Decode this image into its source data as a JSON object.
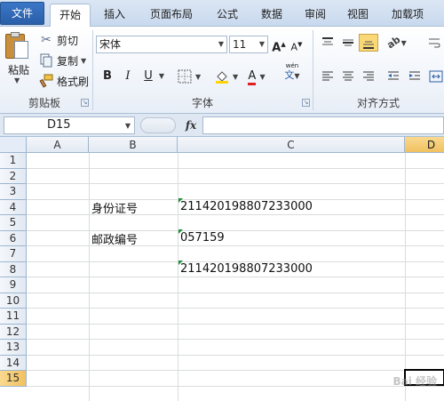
{
  "ribbon_tabs": [
    {
      "label": "文件"
    },
    {
      "label": "开始"
    },
    {
      "label": "插入"
    },
    {
      "label": "页面布局"
    },
    {
      "label": "公式"
    },
    {
      "label": "数据"
    },
    {
      "label": "审阅"
    },
    {
      "label": "视图"
    },
    {
      "label": "加载项"
    }
  ],
  "clipboard": {
    "paste": "粘贴",
    "cut": "剪切",
    "copy": "复制",
    "format_painter": "格式刷",
    "group": "剪贴板"
  },
  "font": {
    "name": "宋体",
    "size": "11",
    "bold": "B",
    "italic": "I",
    "underline": "U",
    "group": "字体",
    "font_color": "A",
    "phonetic": "wén"
  },
  "alignment": {
    "group": "对齐方式"
  },
  "formula_bar": {
    "name_box": "D15",
    "fx": "fx",
    "value": ""
  },
  "columns": [
    {
      "label": "A"
    },
    {
      "label": "B"
    },
    {
      "label": "C"
    },
    {
      "label": "D"
    }
  ],
  "rows": [
    "1",
    "2",
    "3",
    "4",
    "5",
    "6",
    "7",
    "8",
    "9",
    "10",
    "11",
    "12",
    "13",
    "14",
    "15"
  ],
  "cells": {
    "B4": "身份证号",
    "C4": "211420198807233000",
    "B6": "邮政编号",
    "C6": "057159",
    "C8": "211420198807233000"
  },
  "watermark": "Bai 经验",
  "colors": {
    "file_tab": "#2a5fa8",
    "selected_header": "#f1c15f",
    "number_flag": "#1f8f3c",
    "grid_line": "#dadcdd"
  }
}
